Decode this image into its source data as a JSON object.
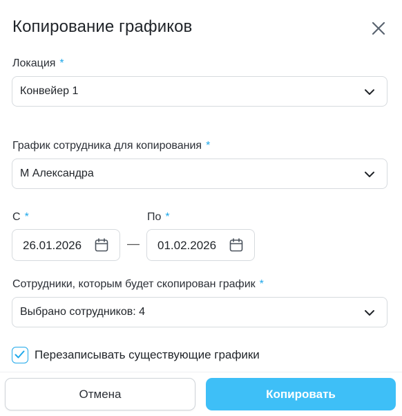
{
  "dialog": {
    "title": "Копирование графиков",
    "close_icon": "close-icon"
  },
  "location": {
    "label": "Локация",
    "required_mark": "*",
    "value": "Конвейер 1"
  },
  "source_schedule": {
    "label": "График сотрудника для копирования",
    "required_mark": "*",
    "value": "М Александра"
  },
  "date_from": {
    "label": "С",
    "required_mark": "*",
    "value": "26.01.2026"
  },
  "date_separator": "—",
  "date_to": {
    "label": "По",
    "required_mark": "*",
    "value": "01.02.2026"
  },
  "target_employees": {
    "label": "Сотрудники, которым будет скопирован график",
    "required_mark": "*",
    "value": "Выбрано сотрудников: 4"
  },
  "overwrite": {
    "label": "Перезаписывать существующие графики",
    "checked": true
  },
  "actions": {
    "cancel_label": "Отмена",
    "copy_label": "Копировать"
  },
  "colors": {
    "accent": "#1fa8ea",
    "primary_button": "#3ebff7",
    "border": "#d6dade"
  }
}
